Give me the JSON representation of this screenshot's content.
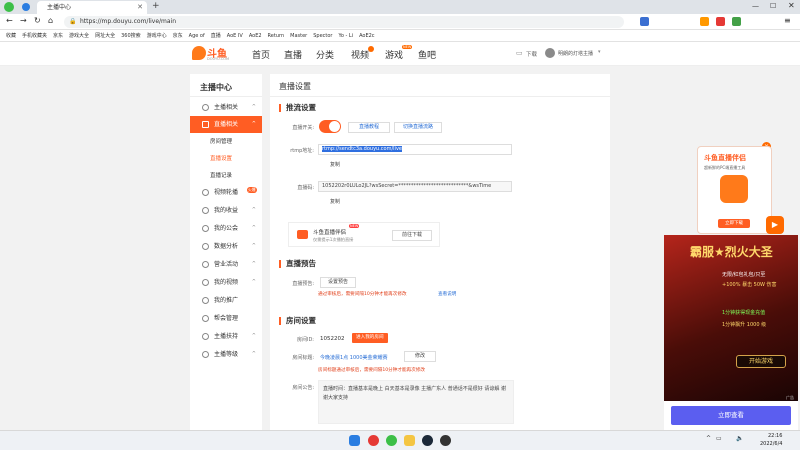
{
  "browser": {
    "tab_title": "主播中心",
    "url": "https://mp.douyu.com/live/main",
    "bookmarks": [
      "收藏",
      "手机收藏夹",
      "京东",
      "游戏大全",
      "网址大全",
      "360搜索",
      "游戏中心",
      "京东",
      "Age of",
      "直播",
      "AoE IV",
      "AoE2",
      "Return",
      "Master",
      "Spector",
      "Yo - Li",
      "AoE2c"
    ]
  },
  "site": {
    "logo_text": "斗鱼",
    "logo_sub": "DOUYU.COM",
    "nav": [
      "首页",
      "直播",
      "分类",
      "视频",
      "游戏",
      "鱼吧"
    ],
    "nav_game_badge": "NEW",
    "download_label": "下载",
    "user_name": "明朗的灯塔主播"
  },
  "sidebar": {
    "title": "主播中心",
    "items": [
      {
        "label": "主播相关",
        "arrow": "^"
      },
      {
        "label": "直播相关",
        "arrow": "^",
        "active": true
      },
      {
        "label": "房间管理",
        "sub": true
      },
      {
        "label": "直播设置",
        "sub": true,
        "active_sub": true
      },
      {
        "label": "直播记录",
        "sub": true
      },
      {
        "label": "视频轮播",
        "badge": "火爆"
      },
      {
        "label": "我的收益",
        "arrow": "^"
      },
      {
        "label": "我的公会",
        "arrow": "^"
      },
      {
        "label": "数据分析",
        "arrow": "^"
      },
      {
        "label": "营业活动",
        "arrow": "^"
      },
      {
        "label": "我的视频",
        "arrow": "^"
      },
      {
        "label": "我的推广"
      },
      {
        "label": "帮会管理"
      },
      {
        "label": "主播扶持",
        "arrow": "^"
      },
      {
        "label": "主播等级",
        "arrow": "^"
      }
    ]
  },
  "main": {
    "page_title": "直播设置",
    "stream_section": {
      "title": "推流设置",
      "switch_label": "直播开关:",
      "switch_on": true,
      "tutorial_link": "直播教程",
      "category_link": "切换直播流路",
      "rtmp_label": "rtmp地址:",
      "rtmp_value": "rtmp://sendtc3a.douyu.com/live",
      "copy_label": "复制",
      "key_label": "直播码:",
      "key_value": "1052202r0LULo2JL?wsSecret=****************************&wsTime",
      "copy_label2": "复制",
      "helper_title": "斗鱼直播伴侣",
      "helper_badge": "NEW",
      "helper_sub": "仅需提示1次播拍直接",
      "helper_download": "前往下载"
    },
    "notice_section": {
      "title": "直播预告",
      "label": "直播预告:",
      "button": "设置预告",
      "warning": "通过审核后，需要间隔10分钟才能再次修改",
      "link": "查看说明"
    },
    "room_section": {
      "title": "房间设置",
      "room_id_label": "房间ID:",
      "room_id": "1052202",
      "room_badge": "进入我的房间",
      "room_title_label": "房间标题:",
      "room_title": "今晚凌晨1点 1000美金荣耀赛",
      "modify_button": "修改",
      "title_warning": "房间标题通过审核后，需要间隔10分钟才能再次修改",
      "announce_label": "房间公告:",
      "announce_text": "直播时间：直播基本是晚上 白天基本是录像 主播广东人 普通话不是很好 请谅解 谢谢大家支持"
    }
  },
  "ads": {
    "helper_card_title": "斗鱼直播伴侣",
    "helper_card_sub": "超新鲜的PC端直播工具",
    "helper_card_button": "立即下载",
    "game_title": "霸服★烈火大圣",
    "game_line1": "无限/红包礼包/只至",
    "game_line2": "+100% 暴击 50W 伤害",
    "game_line3": "1分钟获得现金充值",
    "game_line4": "1分钟飘升 1000 级",
    "game_button": "开始游戏",
    "game_cta": "立即查看",
    "ad_tag": "广告"
  },
  "taskbar": {
    "time": "22:16",
    "date": "2022/6/4"
  },
  "colors": {
    "accent": "#ff5d23",
    "link": "#2a6fd6",
    "warn": "#e1401b",
    "cta": "#5b5ef0"
  }
}
